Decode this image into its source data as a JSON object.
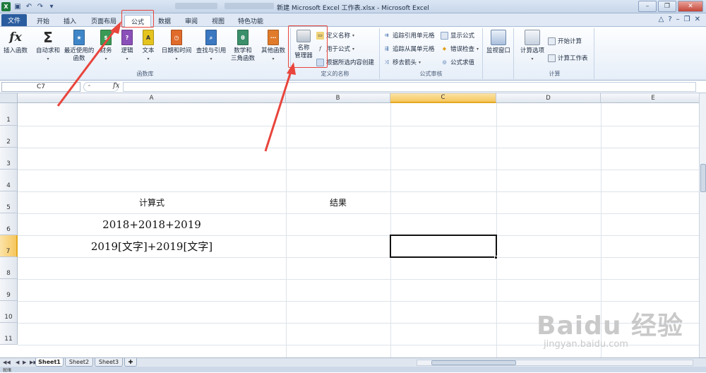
{
  "window": {
    "title": "新建 Microsoft Excel 工作表.xlsx - Microsoft Excel",
    "app_icon": "X"
  },
  "tabs": {
    "file": "文件",
    "items": [
      "开始",
      "插入",
      "页面布局",
      "公式",
      "数据",
      "审阅",
      "视图",
      "特色功能"
    ],
    "active": "公式"
  },
  "ribbon": {
    "function_library": {
      "label": "函数库",
      "insert_function": "插入函数",
      "autosum": "自动求和",
      "recent_1": "最近使用的",
      "recent_2": "函数",
      "finance": "财务",
      "logic": "逻辑",
      "text": "文本",
      "datetime": "日期和时间",
      "lookup": "查找与引用",
      "math_1": "数学和",
      "math_2": "三角函数",
      "other": "其他函数"
    },
    "defined_names": {
      "label": "定义的名称",
      "name_manager_1": "名称",
      "name_manager_2": "管理器",
      "define_name": "定义名称",
      "use_in_formula": "用于公式",
      "create_from_selection": "根据所选内容创建"
    },
    "formula_auditing": {
      "label": "公式审核",
      "trace_precedents": "追踪引用单元格",
      "trace_dependents": "追踪从属单元格",
      "remove_arrows": "移去箭头",
      "show_formulas": "显示公式",
      "error_checking": "错误检查",
      "evaluate_formula": "公式求值",
      "watch_window": "监视窗口"
    },
    "calculation": {
      "label": "计算",
      "options": "计算选项",
      "calc_now": "开始计算",
      "calc_sheet": "计算工作表"
    }
  },
  "formula_bar": {
    "name_box": "C7",
    "fx": "fx",
    "value": ""
  },
  "sheet": {
    "columns": [
      "A",
      "B",
      "C",
      "D",
      "E"
    ],
    "selected_column": "C",
    "rows": [
      "1",
      "2",
      "3",
      "4",
      "5",
      "6",
      "7",
      "8",
      "9",
      "10",
      "11"
    ],
    "selected_row": "7",
    "cells": {
      "A5": "计算式",
      "B5": "结果",
      "A6": "2018+2018+2019",
      "A7": "2019[文字]+2019[文字]"
    }
  },
  "sheet_tabs": [
    "Sheet1",
    "Sheet2",
    "Sheet3"
  ],
  "active_sheet": "Sheet1",
  "status": "就绪",
  "watermark": {
    "brand": "Baidu 经验",
    "url": "jingyan.baidu.com"
  },
  "colors": {
    "file_tab": "#2a5d9f",
    "highlight": "#e8453c",
    "selected_header": "#f6c75e",
    "excel_green": "#1d7a3c"
  }
}
